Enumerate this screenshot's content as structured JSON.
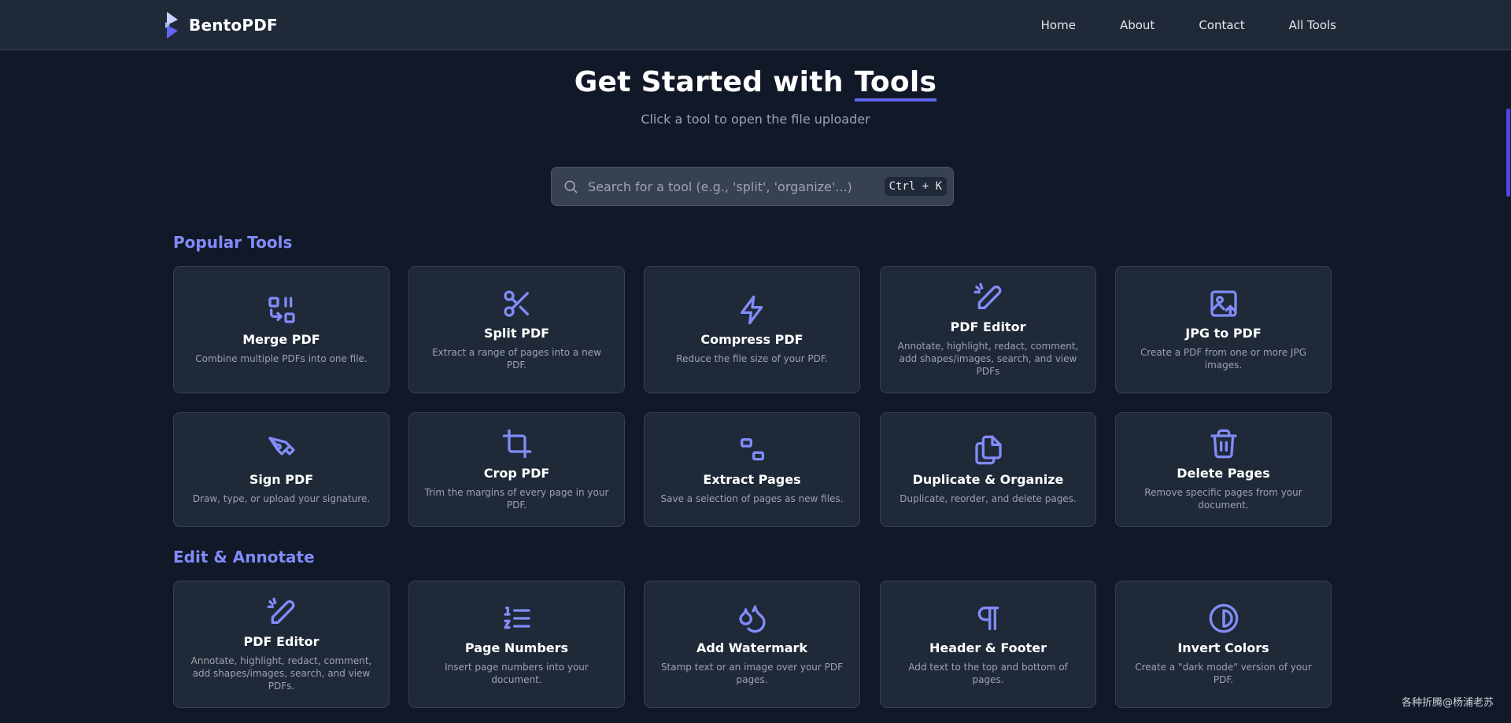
{
  "brand": {
    "name": "BentoPDF"
  },
  "nav": [
    "Home",
    "About",
    "Contact",
    "All Tools"
  ],
  "hero": {
    "title": "Get Started with",
    "title_accent": "Tools",
    "subtitle": "Click a tool to open the file uploader"
  },
  "search": {
    "placeholder": "Search for a tool (e.g., 'split', 'organize'...)",
    "shortcut": "Ctrl + K"
  },
  "sections": [
    {
      "title": "Popular Tools",
      "tools": [
        {
          "icon": "merge-icon",
          "title": "Merge PDF",
          "desc": "Combine multiple PDFs into one file."
        },
        {
          "icon": "scissors-icon",
          "title": "Split PDF",
          "desc": "Extract a range of pages into a new PDF."
        },
        {
          "icon": "lightning-icon",
          "title": "Compress PDF",
          "desc": "Reduce the file size of your PDF."
        },
        {
          "icon": "pen-edit-icon",
          "title": "PDF Editor",
          "desc": "Annotate, highlight, redact, comment, add shapes/images, search, and view PDFs"
        },
        {
          "icon": "image-upload-icon",
          "title": "JPG to PDF",
          "desc": "Create a PDF from one or more JPG images."
        },
        {
          "icon": "signature-pen-icon",
          "title": "Sign PDF",
          "desc": "Draw, type, or upload your signature."
        },
        {
          "icon": "crop-icon",
          "title": "Crop PDF",
          "desc": "Trim the margins of every page in your PDF."
        },
        {
          "icon": "extract-pages-icon",
          "title": "Extract Pages",
          "desc": "Save a selection of pages as new files."
        },
        {
          "icon": "copy-icon",
          "title": "Duplicate & Organize",
          "desc": "Duplicate, reorder, and delete pages."
        },
        {
          "icon": "trash-icon",
          "title": "Delete Pages",
          "desc": "Remove specific pages from your document."
        }
      ]
    },
    {
      "title": "Edit & Annotate",
      "tools": [
        {
          "icon": "pen-edit-icon",
          "title": "PDF Editor",
          "desc": "Annotate, highlight, redact, comment, add shapes/images, search, and view PDFs."
        },
        {
          "icon": "numbered-list-icon",
          "title": "Page Numbers",
          "desc": "Insert page numbers into your document."
        },
        {
          "icon": "droplets-icon",
          "title": "Add Watermark",
          "desc": "Stamp text or an image over your PDF pages."
        },
        {
          "icon": "pilcrow-icon",
          "title": "Header & Footer",
          "desc": "Add text to the top and bottom of pages."
        },
        {
          "icon": "contrast-icon",
          "title": "Invert Colors",
          "desc": "Create a \"dark mode\" version of your PDF."
        }
      ]
    }
  ],
  "watermark": "各种折腾@杨浦老苏",
  "colors": {
    "accent": "#818cf8",
    "underline": "#6366f1",
    "bg": "#111827",
    "card": "#1f2937"
  }
}
